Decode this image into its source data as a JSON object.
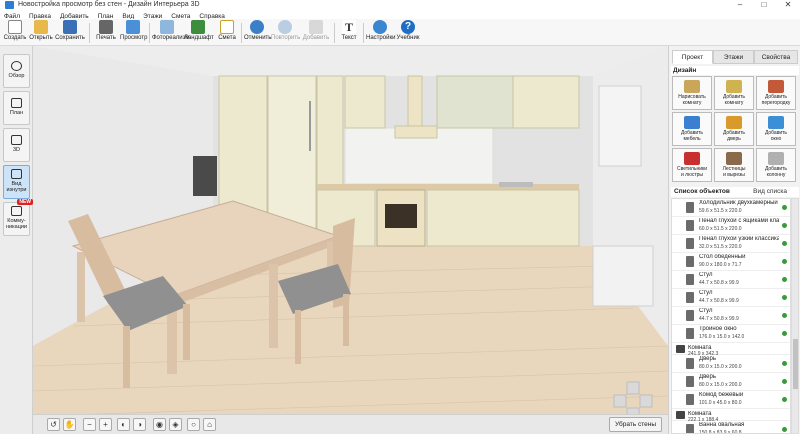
{
  "window": {
    "title": "Новостройка просмотр без стен - Дизайн Интерьера 3D",
    "controls": [
      "–",
      "□",
      "✕"
    ]
  },
  "menu": [
    "Файл",
    "Правка",
    "Добавить",
    "План",
    "Вид",
    "Этажи",
    "Смета",
    "Справка"
  ],
  "toolbar": {
    "create": "Создать",
    "open": "Открыть",
    "save": "Сохранить",
    "print": "Печать",
    "preview": "Просмотр",
    "photorealism": "Фотореализм",
    "landscape": "Ландшафт",
    "estimate": "Смета",
    "undo": "Отменить",
    "redo": "Повторить",
    "add_to_favorites": "Добавить",
    "text": "Текст",
    "settings": "Настройки",
    "tutorial": "Учебник"
  },
  "left_sidebar": {
    "overview": "Обзор",
    "plan": "План",
    "view3d": "3D",
    "virtual_visit_line1": "Вид",
    "virtual_visit_line2": "изнутри",
    "communications_line1": "Комму-",
    "communications_line2": "никации",
    "new_badge": "NEW"
  },
  "bottom_bar": {
    "remove_walls": "Убрать стены"
  },
  "right_panel": {
    "tabs": [
      "Проект",
      "Этажи",
      "Свойства"
    ],
    "active_tab": "Проект",
    "design_header": "Дизайн",
    "design_buttons": [
      {
        "line1": "Нарисовать",
        "line2": "комнату"
      },
      {
        "line1": "Добавить",
        "line2": "комнату"
      },
      {
        "line1": "Добавить",
        "line2": "перегородку"
      },
      {
        "line1": "Добавить",
        "line2": "мебель"
      },
      {
        "line1": "Добавить",
        "line2": "дверь"
      },
      {
        "line1": "Добавить",
        "line2": "окно"
      },
      {
        "line1": "Светильники",
        "line2": "и люстры"
      },
      {
        "line1": "Лестницы",
        "line2": "и вырезы"
      },
      {
        "line1": "Добавить",
        "line2": "колонну"
      }
    ],
    "objects_header": "Список объектов",
    "view_mode": "Вид списка",
    "objects": [
      {
        "name": "Холодильник двухкамерный бе...",
        "dims": "59.6 x 51.5 x 220.0",
        "group": false
      },
      {
        "name": "Пенал глухой с ящиками классис...",
        "dims": "60.0 x 51.5 x 220.0",
        "group": false
      },
      {
        "name": "Пенал глухой узкий классика",
        "dims": "32.0 x 51.5 x 220.0",
        "group": false
      },
      {
        "name": "Стол обеденный",
        "dims": "90.0 x 180.0 x 71.7",
        "group": false
      },
      {
        "name": "Стул",
        "dims": "44.7 x 50.8 x 99.9",
        "group": false
      },
      {
        "name": "Стул",
        "dims": "44.7 x 50.8 x 99.9",
        "group": false
      },
      {
        "name": "Стул",
        "dims": "44.7 x 50.8 x 99.9",
        "group": false
      },
      {
        "name": "Тройное окно",
        "dims": "176.0 x 15.0 x 142.0",
        "group": false
      },
      {
        "name": "Комната",
        "dims": "241.9 x 342.3",
        "group": true
      },
      {
        "name": "Дверь",
        "dims": "80.0 x 15.0 x 200.0",
        "group": false
      },
      {
        "name": "Дверь",
        "dims": "80.0 x 15.0 x 200.0",
        "group": false
      },
      {
        "name": "Комод бежевый",
        "dims": "101.0 x 45.0 x 80.0",
        "group": false
      },
      {
        "name": "Комната",
        "dims": "222.1 x 188.4",
        "group": true
      },
      {
        "name": "Ванна овальная",
        "dims": "150.8 x 83.9 x 60.8",
        "group": false
      }
    ]
  },
  "colors": {
    "cabinet": "#ece9cf",
    "floor": "#e8d6bd",
    "wall": "#e6e6e6",
    "accent": "#2d7dd2"
  }
}
